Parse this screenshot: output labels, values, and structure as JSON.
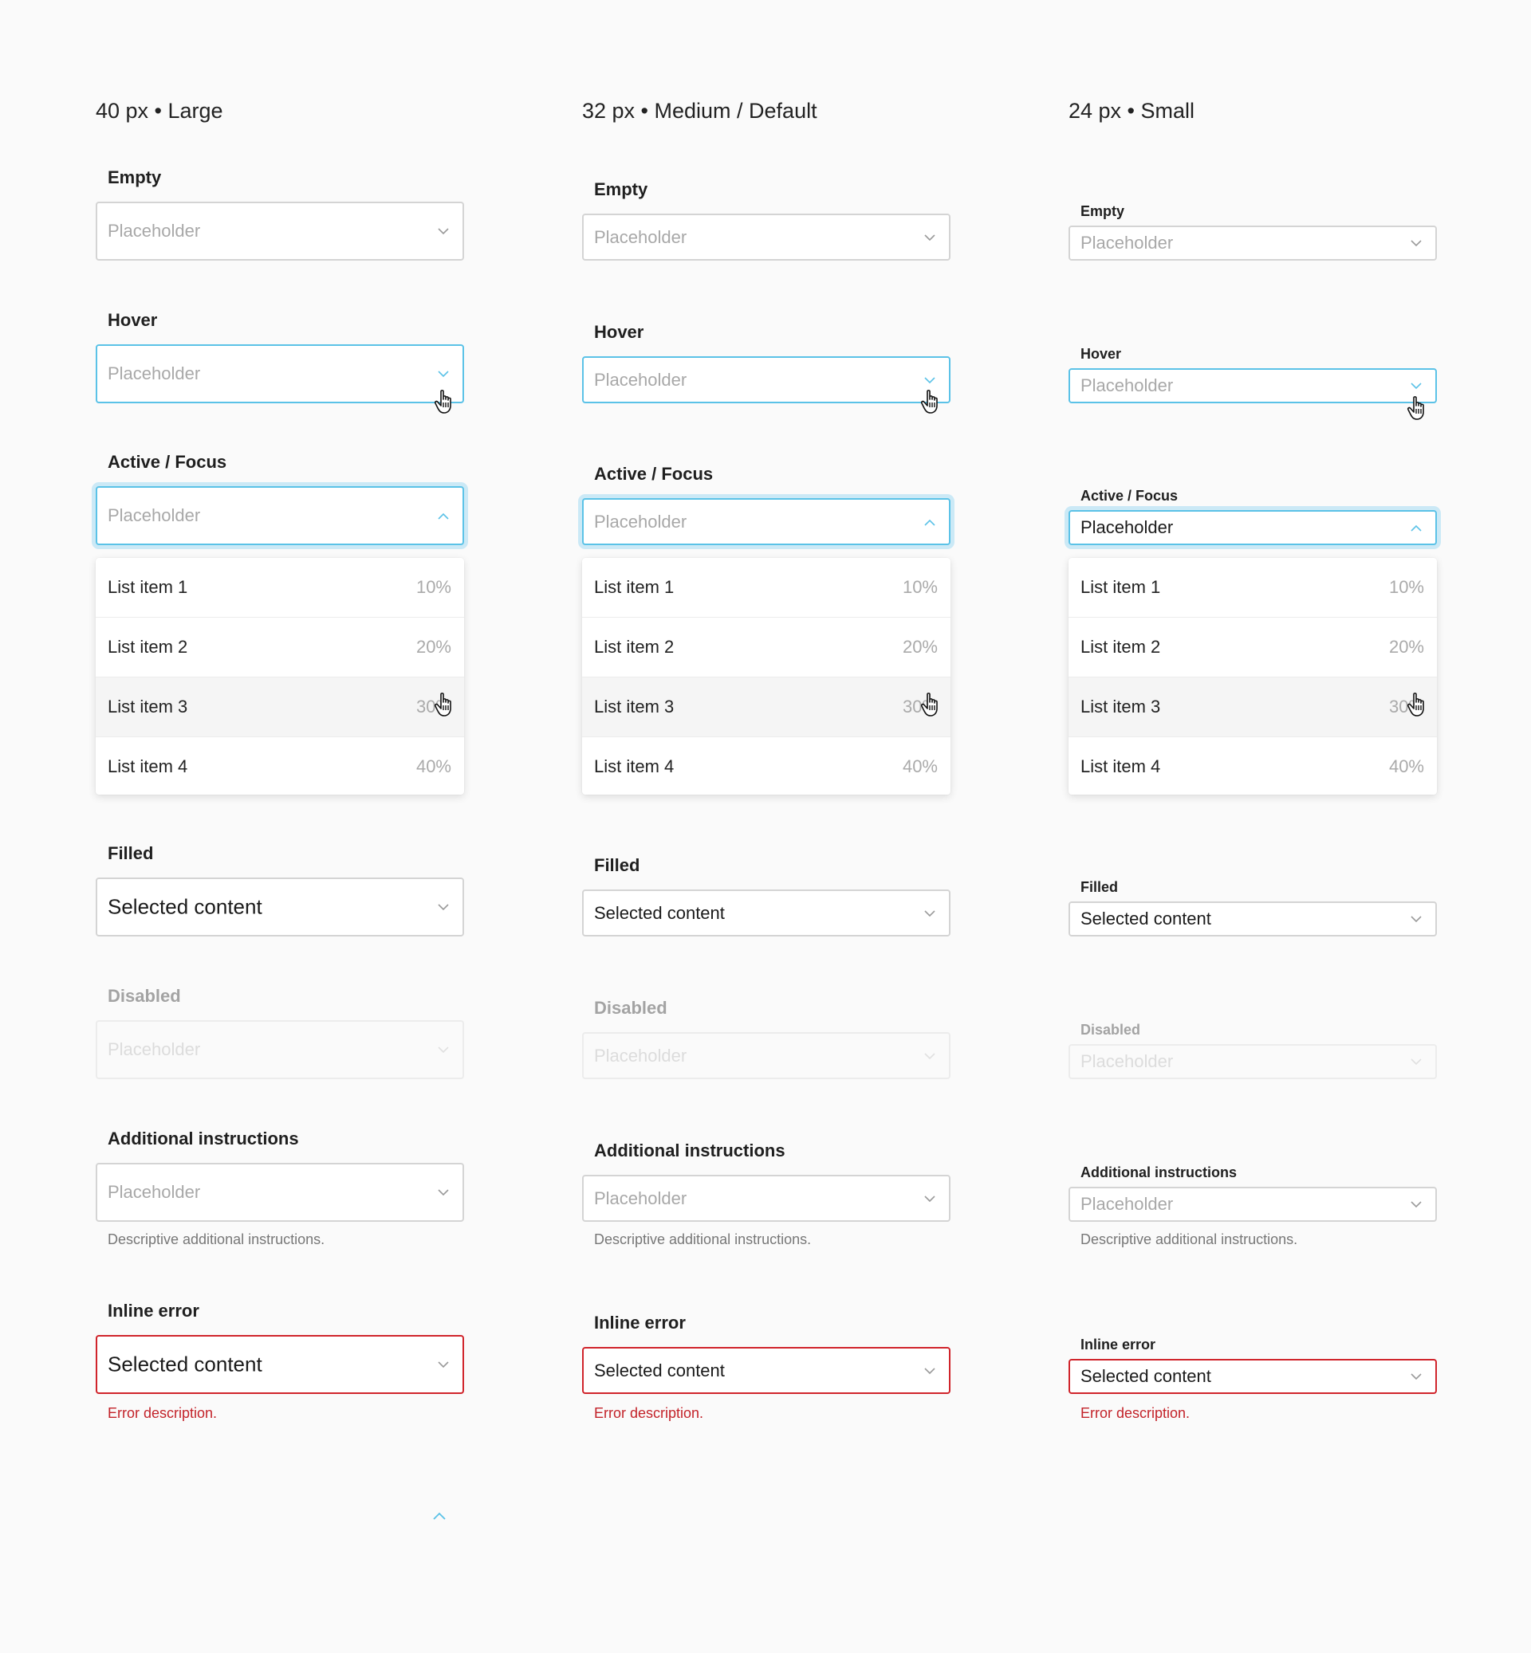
{
  "columns": [
    {
      "title": "40 px • Large",
      "empty": {
        "label": "Empty",
        "placeholder": "Placeholder"
      },
      "hover": {
        "label": "Hover",
        "placeholder": "Placeholder"
      },
      "focus": {
        "label": "Active / Focus",
        "placeholder": "Placeholder"
      },
      "list": [
        {
          "label": "List item 1",
          "value": "10%"
        },
        {
          "label": "List item 2",
          "value": "20%"
        },
        {
          "label": "List item 3",
          "value": "30%"
        },
        {
          "label": "List item 4",
          "value": "40%"
        }
      ],
      "filled": {
        "label": "Filled",
        "value": "Selected content"
      },
      "disabled": {
        "label": "Disabled",
        "placeholder": "Placeholder"
      },
      "additional": {
        "label": "Additional instructions",
        "placeholder": "Placeholder",
        "helper": "Descriptive additional instructions."
      },
      "error": {
        "label": "Inline error",
        "value": "Selected content",
        "helper": "Error description."
      }
    },
    {
      "title": "32 px • Medium / Default",
      "empty": {
        "label": "Empty",
        "placeholder": "Placeholder"
      },
      "hover": {
        "label": "Hover",
        "placeholder": "Placeholder"
      },
      "focus": {
        "label": "Active / Focus",
        "placeholder": "Placeholder"
      },
      "list": [
        {
          "label": "List item 1",
          "value": "10%"
        },
        {
          "label": "List item 2",
          "value": "20%"
        },
        {
          "label": "List item 3",
          "value": "30%"
        },
        {
          "label": "List item 4",
          "value": "40%"
        }
      ],
      "filled": {
        "label": "Filled",
        "value": "Selected content"
      },
      "disabled": {
        "label": "Disabled",
        "placeholder": "Placeholder"
      },
      "additional": {
        "label": "Additional instructions",
        "placeholder": "Placeholder",
        "helper": "Descriptive additional instructions."
      },
      "error": {
        "label": "Inline error",
        "value": "Selected content",
        "helper": "Error description."
      }
    },
    {
      "title": "24 px • Small",
      "empty": {
        "label": "Empty",
        "placeholder": "Placeholder"
      },
      "hover": {
        "label": "Hover",
        "placeholder": "Placeholder"
      },
      "focus": {
        "label": "Active / Focus",
        "placeholder": "Placeholder"
      },
      "list": [
        {
          "label": "List item 1",
          "value": "10%"
        },
        {
          "label": "List item 2",
          "value": "20%"
        },
        {
          "label": "List item 3",
          "value": "30%"
        },
        {
          "label": "List item 4",
          "value": "40%"
        }
      ],
      "filled": {
        "label": "Filled",
        "value": "Selected content"
      },
      "disabled": {
        "label": "Disabled",
        "placeholder": "Placeholder"
      },
      "additional": {
        "label": "Additional instructions",
        "placeholder": "Placeholder",
        "helper": "Descriptive additional instructions."
      },
      "error": {
        "label": "Inline error",
        "value": "Selected content",
        "helper": "Error description."
      }
    }
  ],
  "colors": {
    "background": "#fafafa",
    "focus_blue": "#5bc2e7",
    "focus_ring": "#cbe9f6",
    "error_red": "#d0242b",
    "placeholder": "#a8a8a8"
  },
  "icons": {
    "chevron_down": "chevron-down-icon",
    "chevron_up": "chevron-up-icon",
    "cursor": "hand-pointer-icon"
  }
}
